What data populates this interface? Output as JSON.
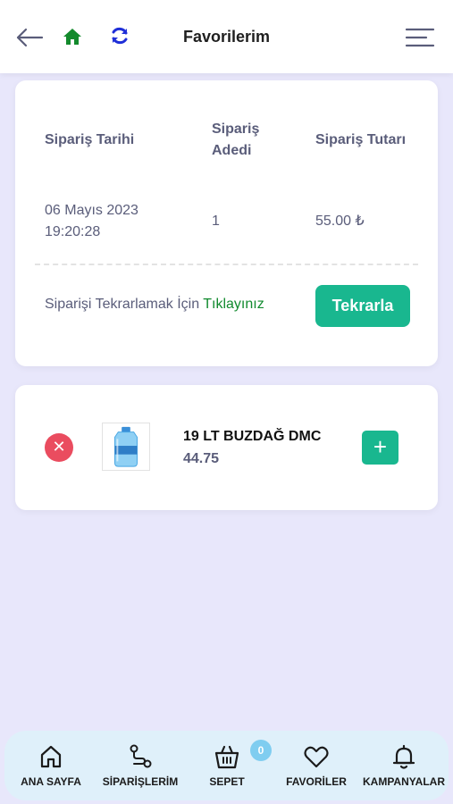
{
  "header": {
    "title": "Favorilerim",
    "icons": {
      "back": "arrow-left-icon",
      "home": "home-icon",
      "refresh": "refresh-icon",
      "menu": "menu-icon"
    },
    "colors": {
      "home": "#138a2c",
      "refresh": "#1f2fd8"
    }
  },
  "order": {
    "headers": {
      "date": "Sipariş Tarihi",
      "qty_line1": "Sipariş",
      "qty_line2": "Adedi",
      "total": "Sipariş Tutarı"
    },
    "date_line1": "06 Mayıs 2023",
    "date_line2": "19:20:28",
    "qty": "1",
    "total": "55.00 ₺",
    "repeat_text": "Siparişi Tekrarlamak İçin",
    "repeat_link": "Tıklayınız",
    "repeat_button": "Tekrarla"
  },
  "product": {
    "name": "19 LT BUZDAĞ DMC",
    "price": "44.75",
    "remove_symbol": "✕",
    "add_symbol": "+"
  },
  "bottom_nav": {
    "items": [
      {
        "label": "ANA SAYFA",
        "icon": "home-outline-icon"
      },
      {
        "label": "SİPARİŞLERİM",
        "icon": "route-icon"
      },
      {
        "label": "SEPET",
        "icon": "basket-icon"
      },
      {
        "label": "FAVORİLER",
        "icon": "heart-icon"
      },
      {
        "label": "KAMPANYALAR",
        "icon": "bell-icon"
      }
    ],
    "cart_badge": "0"
  },
  "colors": {
    "accent": "#19b78f",
    "danger": "#ea4c5f",
    "background": "#e8e7fb",
    "link": "#118a2e"
  }
}
